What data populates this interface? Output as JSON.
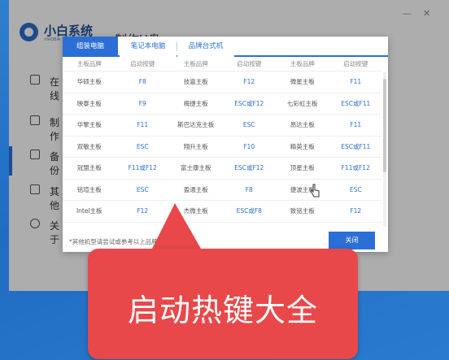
{
  "app": {
    "brand": "小白系统",
    "brand_sub": "XIAOBAI XITONG",
    "title": "制作U盘",
    "minimize": "—",
    "close": "✕"
  },
  "sidebar": {
    "items": [
      {
        "label": "在线",
        "icon": "monitor-icon"
      },
      {
        "label": "备份",
        "icon": "backup-icon"
      },
      {
        "label": "制作",
        "icon": "usb-icon"
      },
      {
        "label": "其他",
        "icon": "home-icon"
      },
      {
        "label": "关于",
        "icon": "info-icon"
      }
    ]
  },
  "dialog": {
    "tabs": [
      "组装电脑",
      "笔记本电脑",
      "品牌台式机"
    ],
    "active_tab": 0,
    "headers": [
      "主板品牌",
      "启动按键",
      "主板品牌",
      "启动按键",
      "主板品牌",
      "启动按键"
    ],
    "rows": [
      [
        "华硕主板",
        "F8",
        "技嘉主板",
        "F12",
        "微星主板",
        "F11"
      ],
      [
        "映泰主板",
        "F9",
        "梅捷主板",
        "ESC或F12",
        "七彩虹主板",
        "ESC或F11"
      ],
      [
        "华擎主板",
        "F11",
        "斯巴达克主板",
        "ESC",
        "昂达主板",
        "F11"
      ],
      [
        "双敏主板",
        "ESC",
        "翔升主板",
        "F10",
        "精英主板",
        "ESC或F11"
      ],
      [
        "冠盟主板",
        "F11或F12",
        "富士康主板",
        "ESC或F12",
        "顶星主板",
        "F11或F12"
      ],
      [
        "铭瑄主板",
        "ESC",
        "盈通主板",
        "F8",
        "捷波主板",
        "ESC"
      ],
      [
        "Intel主板",
        "F12",
        "杰微主板",
        "ESC或F8",
        "致铭主板",
        "F12"
      ]
    ],
    "note": "*其他机型请尝试或参考以上品牌常用启动热键",
    "close_label": "关闭"
  },
  "callout": {
    "text": "启动热键大全"
  },
  "colors": {
    "accent": "#2b6fd6",
    "callout": "#e8484a"
  }
}
